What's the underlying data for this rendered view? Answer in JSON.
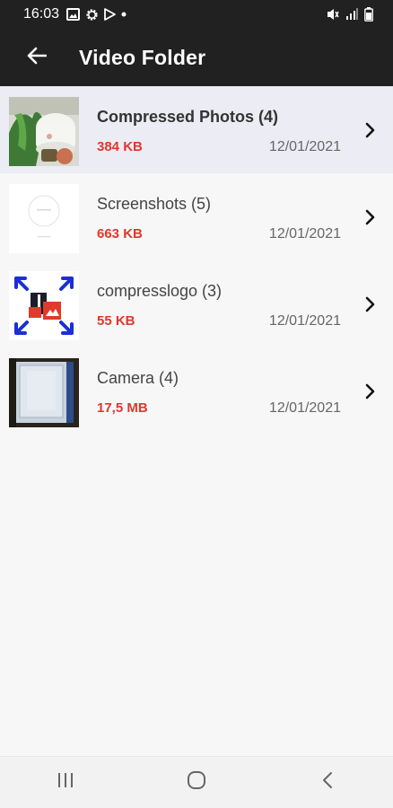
{
  "status_bar": {
    "time": "16:03",
    "icons": [
      "image-icon",
      "settings-icon",
      "play-store-icon",
      "dot-icon"
    ],
    "right_icons": [
      "vibrate-mute-icon",
      "signal-icon",
      "battery-icon"
    ]
  },
  "app_bar": {
    "back_icon": "arrow-left-icon",
    "title": "Video Folder"
  },
  "folders": [
    {
      "name": "Compressed Photos (4)",
      "size": "384 KB",
      "date": "12/01/2021",
      "selected": true
    },
    {
      "name": "Screenshots (5)",
      "size": "663 KB",
      "date": "12/01/2021",
      "selected": false
    },
    {
      "name": "compresslogo (3)",
      "size": "55 KB",
      "date": "12/01/2021",
      "selected": false
    },
    {
      "name": "Camera (4)",
      "size": "17,5 MB",
      "date": "12/01/2021",
      "selected": false
    }
  ],
  "colors": {
    "bar": "#212121",
    "size_text": "#e0372d",
    "selected_row": "#ececf4",
    "background": "#f7f7f7"
  },
  "nav_bar": {
    "buttons": [
      "recent-apps-icon",
      "home-icon",
      "back-icon"
    ]
  }
}
